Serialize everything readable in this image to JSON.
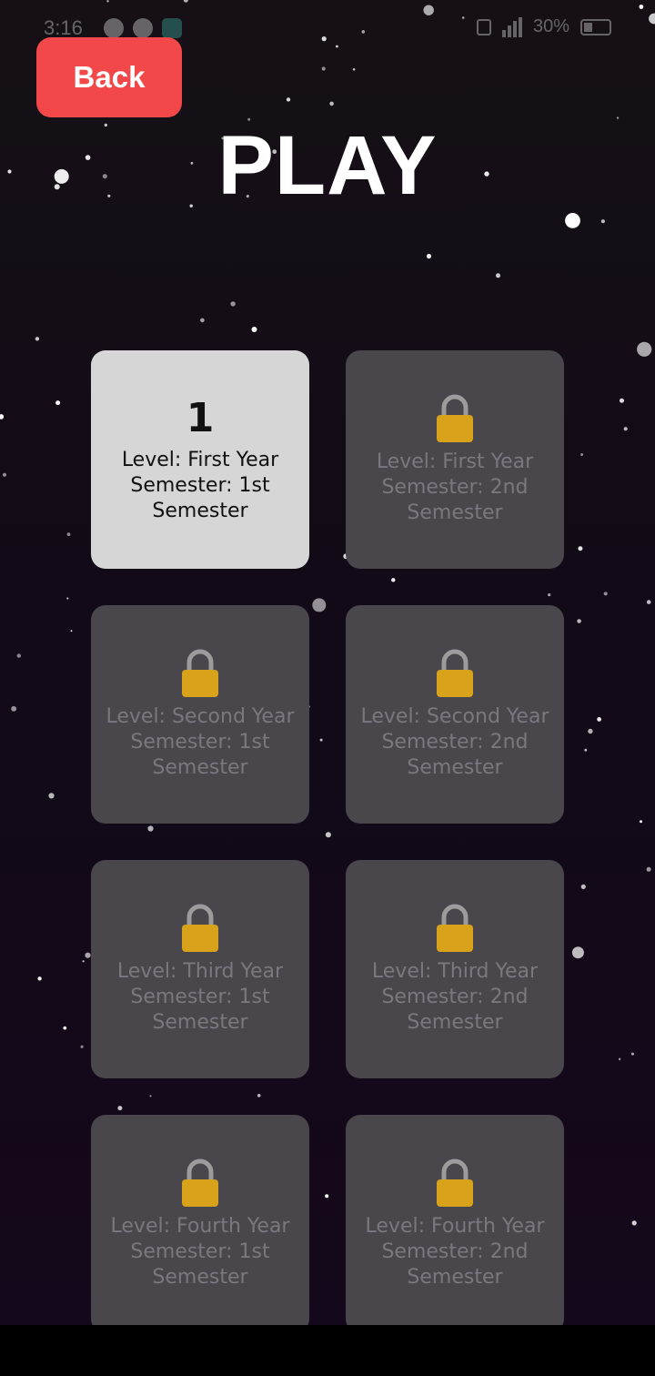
{
  "status_bar": {
    "time": "3:16",
    "battery": "30%"
  },
  "header": {
    "back_label": "Back",
    "title": "PLAY"
  },
  "colors": {
    "back_button": "#f2484a",
    "unlocked_card": "#d6d6d6",
    "locked_card": "#4a474c",
    "lock_body": "#d9a21b",
    "lock_shackle": "#9c9c9c"
  },
  "levels": [
    {
      "number": "1",
      "label": "Level: First Year Semester: 1st Semester",
      "locked": false
    },
    {
      "number": "",
      "label": "Level: First Year Semester: 2nd Semester",
      "locked": true,
      "icon": "lock-icon"
    },
    {
      "number": "",
      "label": "Level: Second Year Semester: 1st Semester",
      "locked": true,
      "icon": "lock-icon"
    },
    {
      "number": "",
      "label": "Level: Second Year Semester: 2nd Semester",
      "locked": true,
      "icon": "lock-icon"
    },
    {
      "number": "",
      "label": "Level: Third Year Semester: 1st Semester",
      "locked": true,
      "icon": "lock-icon"
    },
    {
      "number": "",
      "label": "Level: Third Year Semester: 2nd Semester",
      "locked": true,
      "icon": "lock-icon"
    },
    {
      "number": "",
      "label": "Level: Fourth Year Semester: 1st Semester",
      "locked": true,
      "icon": "lock-icon"
    },
    {
      "number": "",
      "label": "Level: Fourth Year Semester: 2nd Semester",
      "locked": true,
      "icon": "lock-icon"
    }
  ]
}
